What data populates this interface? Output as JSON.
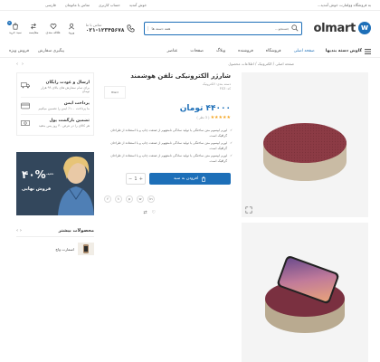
{
  "topbar": {
    "note": "به فروشگاه وولمارت خوش آمدید...",
    "links": [
      "خوش آمدید",
      "حساب کاربری",
      "تماس با ما"
    ],
    "currency": "تومان",
    "language": "فارسی"
  },
  "header": {
    "logo_letter": "w",
    "logo_text": "olmart",
    "search_placeholder": "جستجو...",
    "search_category": "همه دسته ها",
    "phone_label": "تماس با ما",
    "phone_number": "۰۲۱-۱۲۳۴۵۶۷۸",
    "icons": [
      {
        "name": "user-icon",
        "label": "ورود"
      },
      {
        "name": "heart-icon",
        "label": "علاقه مندی"
      },
      {
        "name": "compare-icon",
        "label": "مقایسه"
      },
      {
        "name": "cart-icon",
        "label": "سبد خرید",
        "badge": "0"
      }
    ]
  },
  "nav": {
    "all_categories": "گاوش دسته بندیها",
    "items": [
      "صفحه اصلی",
      "فروشگاه",
      "فروشنده",
      "وبلاگ",
      "صفحات",
      "عناصر"
    ],
    "active_index": 0,
    "extra": [
      "پیگیری سفارش",
      "فروش ویژه"
    ]
  },
  "breadcrumb": "صفحه اصلی / الکترونیک / اطلاعات محصول",
  "product": {
    "title": "شارژر الکترونیکی تلفن هوشمند",
    "meta_lines": [
      "دسته بندی: الکترونیک",
      "کد: FS3"
    ],
    "brand": "Brand",
    "price": "۴۴۰۰۰ تومان",
    "rating_stars": "★★★★★",
    "rating_text": "( 3 نظر )",
    "features": [
      "لورم ایپسوم متن ساختگی با تولید سادگی نامفهوم از صنعت چاپ و با استفاده از طراحان گرافیک است.",
      "لورم ایپسوم متن ساختگی با تولید سادگی نامفهوم از صنعت چاپ و با استفاده از طراحان گرافیک است.",
      "لورم ایپسوم متن ساختگی با تولید سادگی نامفهوم از صنعت چاپ و با استفاده از طراحان گرافیک است."
    ],
    "add_to_cart": "افزودن به سبد",
    "qty": "1",
    "share": [
      "f",
      "t",
      "p",
      "w",
      "in"
    ]
  },
  "sidebar": {
    "services": [
      {
        "title": "ارسال و عودت رایگان",
        "desc": "برای تمام سفارش های بالای ۹۹ هزار تومان",
        "icon": "truck-icon"
      },
      {
        "title": "پرداخت ایمن",
        "desc": "ما پرداخت ۱۰۰٪ ایمن را تضمین میکنیم",
        "icon": "card-icon"
      },
      {
        "title": "تضمین بازگشت پول",
        "desc": "هر کالای را در عرض ۳۰ روز پس بدهید",
        "icon": "money-icon"
      }
    ],
    "banner_percent": "۴۰%",
    "banner_sub": "تخفیف",
    "banner_sale": "فروش نهایی",
    "featured_title": "محصولات بیشتر",
    "featured_items": [
      {
        "name": "اسمارت واچ"
      }
    ]
  },
  "colors": {
    "accent": "#1d6fb8"
  }
}
